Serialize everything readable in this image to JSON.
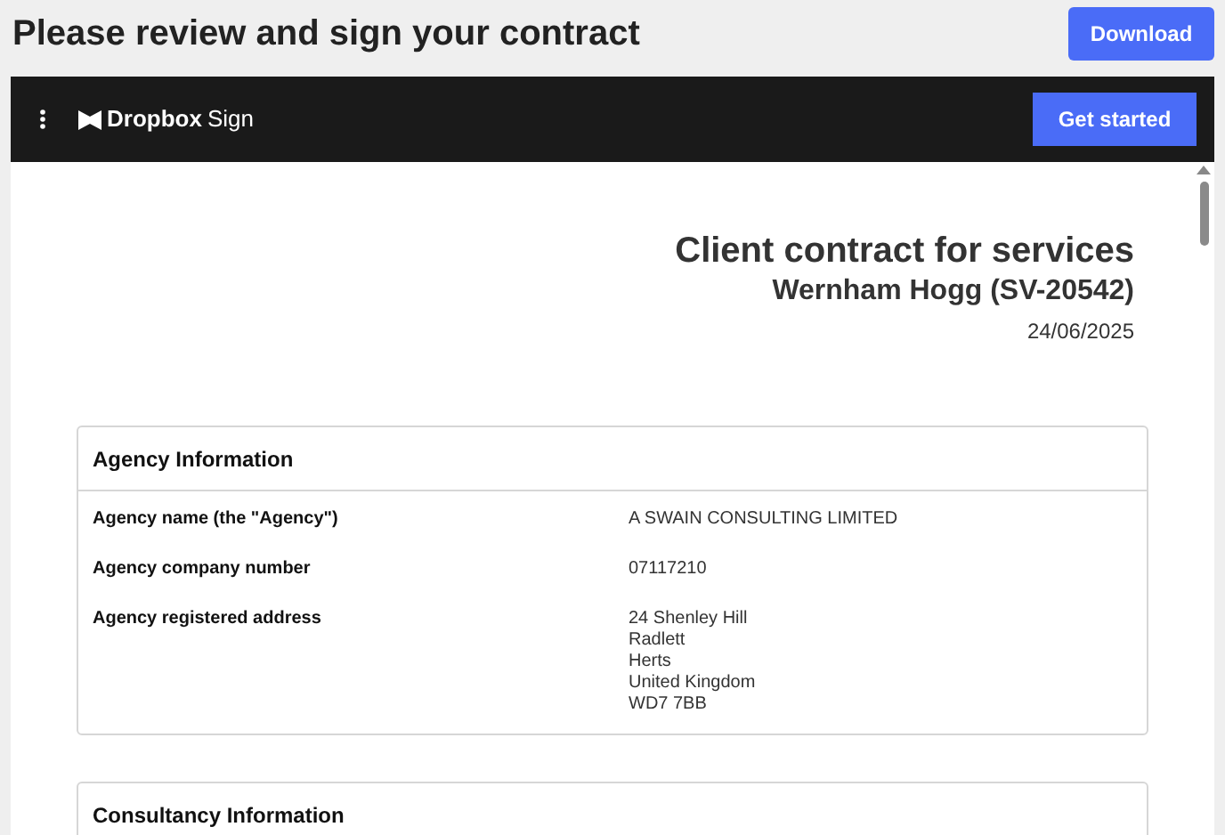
{
  "page_title": "Please review and sign your contract",
  "download_button": "Download",
  "viewer": {
    "brand": {
      "name": "Dropbox",
      "product": "Sign"
    },
    "cta_button": "Get started"
  },
  "document": {
    "title": "Client contract for services",
    "subtitle": "Wernham Hogg (SV-20542)",
    "date": "24/06/2025",
    "sections": [
      {
        "heading": "Agency Information",
        "rows": [
          {
            "label": "Agency name (the \"Agency\")",
            "value_lines": [
              "A SWAIN CONSULTING LIMITED"
            ]
          },
          {
            "label": "Agency company number",
            "value_lines": [
              "07117210"
            ]
          },
          {
            "label": "Agency registered address",
            "value_lines": [
              "24 Shenley Hill",
              "Radlett",
              "Herts",
              "United Kingdom",
              "WD7 7BB"
            ]
          }
        ]
      },
      {
        "heading": "Consultancy Information"
      }
    ]
  }
}
